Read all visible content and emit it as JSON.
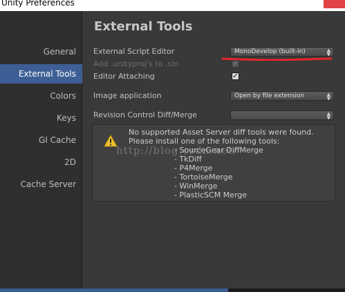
{
  "window": {
    "title": "Unity Preferences"
  },
  "sidebar": {
    "items": [
      {
        "label": "General"
      },
      {
        "label": "External Tools"
      },
      {
        "label": "Colors"
      },
      {
        "label": "Keys"
      },
      {
        "label": "GI Cache"
      },
      {
        "label": "2D"
      },
      {
        "label": "Cache Server"
      }
    ],
    "selected": "External Tools"
  },
  "main": {
    "title": "External Tools",
    "script_editor": {
      "label": "External Script Editor",
      "value": "MonoDevelop (built-in)"
    },
    "add_unityproj": {
      "label": "Add .unityproj's to .sln",
      "checked": true,
      "enabled": false
    },
    "editor_attaching": {
      "label": "Editor Attaching",
      "checked": true
    },
    "image_application": {
      "label": "Image application",
      "value": "Open by file extension"
    },
    "revision_control": {
      "label": "Revision Control Diff/Merge",
      "value": ""
    },
    "help": {
      "lines": [
        "No supported Asset Server diff tools were found.",
        "Please install one of the following tools:",
        "- SourceGear DiffMerge",
        "- TkDiff",
        "- P4Merge",
        "- TortoiseMerge",
        "- WinMerge",
        "- PlasticSCM Merge"
      ],
      "watermark": "http://blog.csdn.net/"
    }
  },
  "colors": {
    "selection": "#3e5f96",
    "annotation_red": "#e8242a",
    "warning_yellow": "#f2c22d"
  },
  "icons": {
    "warning": "warning-triangle-icon",
    "checkmark": "checkmark-icon",
    "dropdown": "dropdown-arrows-icon"
  }
}
